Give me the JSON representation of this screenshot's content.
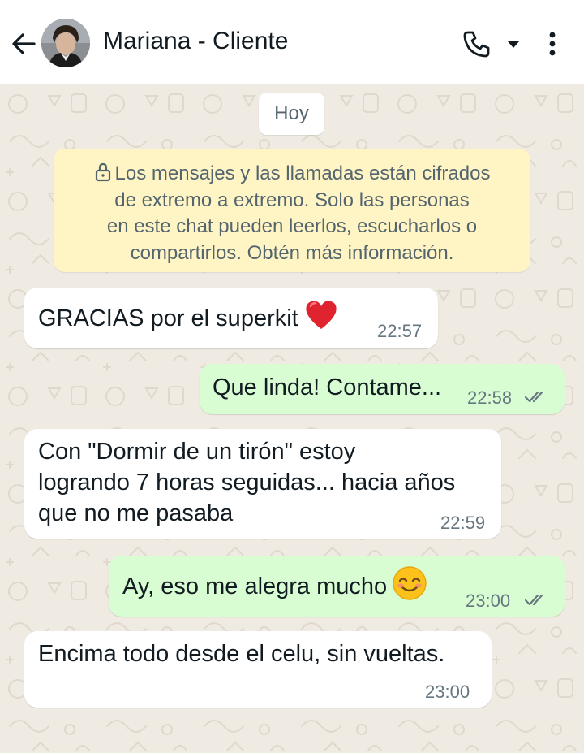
{
  "header": {
    "contact_name": "Mariana - Cliente",
    "icons": [
      "back-arrow-icon",
      "avatar",
      "phone-icon",
      "caret-down-icon",
      "more-vertical-icon"
    ]
  },
  "chat": {
    "date_chip": "Hoy",
    "encryption_notice": {
      "lines": [
        "Los mensajes y las llamadas están cifrados",
        "de extremo a extremo. Solo las personas",
        "en este chat pueden leerlos, escucharlos o",
        "compartirlos. Obtén más información."
      ]
    },
    "messages": [
      {
        "direction": "in",
        "lines": [
          "GRACIAS por el superkit"
        ],
        "emoji": "heart-emoji",
        "time": "22:57"
      },
      {
        "direction": "out",
        "lines": [
          "Que linda! Contame..."
        ],
        "time": "22:58",
        "status": "read"
      },
      {
        "direction": "in",
        "lines": [
          "Con \"Dormir de un tirón\" estoy",
          "logrando 7 horas seguidas... hacia años",
          "que no me pasaba"
        ],
        "time": "22:59"
      },
      {
        "direction": "out",
        "lines": [
          "Ay, eso me alegra mucho"
        ],
        "emoji": "smiling-face-emoji",
        "time": "23:00",
        "status": "read"
      },
      {
        "direction": "in",
        "lines": [
          "Encima todo desde el celu, sin vueltas."
        ],
        "time": "23:00"
      }
    ]
  },
  "colors": {
    "header_bg": "#ffffff",
    "chat_bg": "#efeae2",
    "incoming_bubble": "#ffffff",
    "outgoing_bubble": "#d9fdd3",
    "notice_bg": "#fff5c4",
    "timestamp": "#667781",
    "read_ticks": "#667781"
  }
}
